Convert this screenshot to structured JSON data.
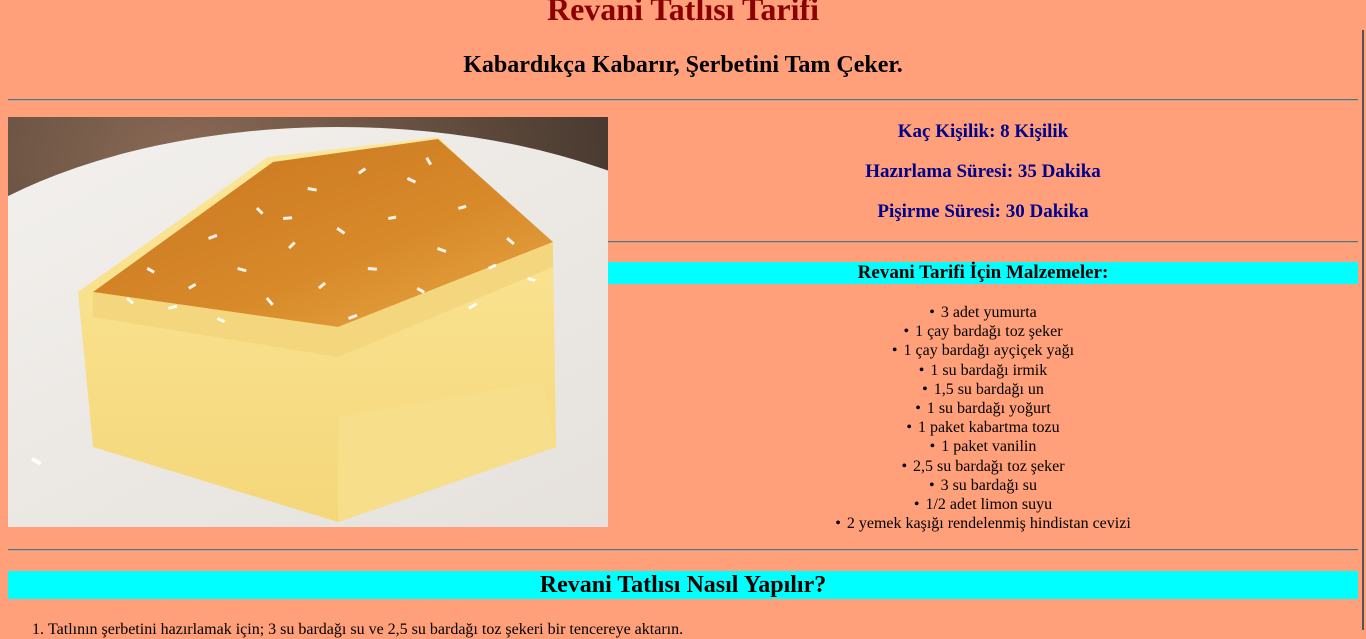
{
  "header": {
    "title": "Revani Tatlısı Tarifi",
    "subtitle": "Kabardıkça Kabarır, Şerbetini Tam Çeker."
  },
  "image": {
    "alt": "Revani Tatlısı",
    "description_icon": "cake-photo"
  },
  "info": {
    "servings": "Kaç Kişilik: 8 Kişilik",
    "prep_time": "Hazırlama Süresi: 35 Dakika",
    "cook_time": "Pişirme Süresi: 30 Dakika"
  },
  "ingredients": {
    "title": "Revani Tarifi İçin Malzemeler:",
    "items": [
      "3 adet yumurta",
      "1 çay bardağı toz şeker",
      "1 çay bardağı ayçiçek yağı",
      "1 su bardağı irmik",
      "1,5 su bardağı un",
      "1 su bardağı yoğurt",
      "1 paket kabartma tozu",
      "1 paket vanilin",
      "2,5 su bardağı toz şeker",
      "3 su bardağı su",
      "1/2 adet limon suyu",
      "2 yemek kaşığı rendelenmiş hindistan cevizi"
    ]
  },
  "instructions": {
    "title": "Revani Tatlısı Nasıl Yapılır?",
    "steps": [
      "Tatlının şerbetini hazırlamak için; 3 su bardağı su ve 2,5 su bardağı toz şekeri bir tencereye aktarın."
    ]
  },
  "colors": {
    "background": "#ffa07a",
    "title": "#8b0000",
    "info": "#00008b",
    "band": "#00ffff"
  }
}
